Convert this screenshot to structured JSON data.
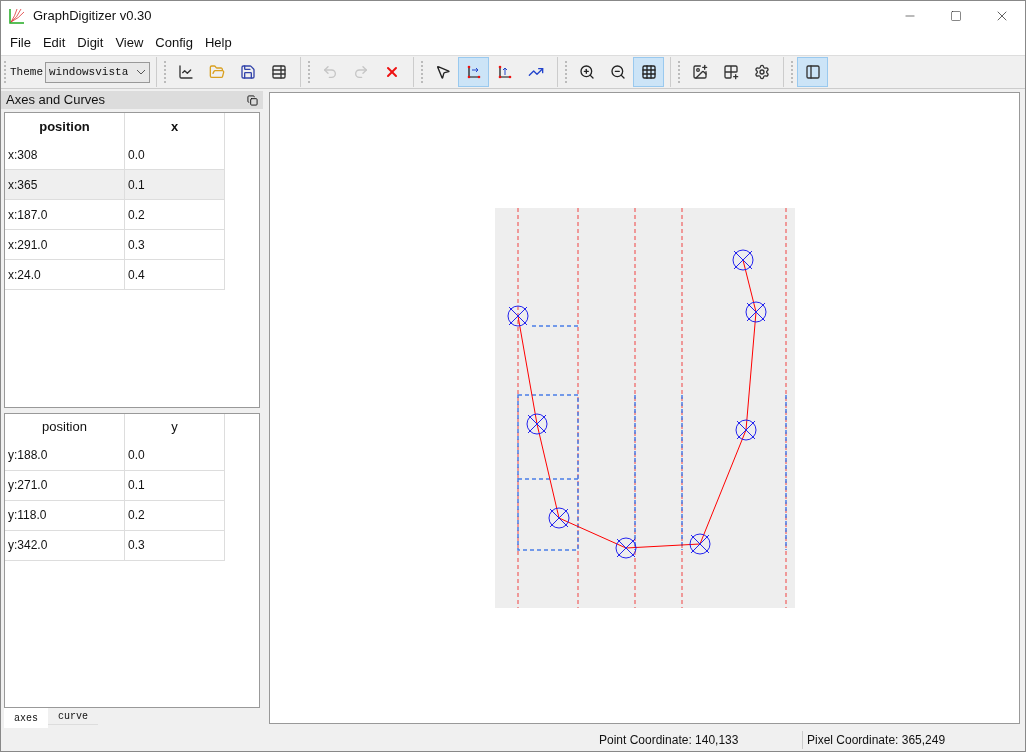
{
  "window": {
    "title": "GraphDigitizer v0.30"
  },
  "menu": [
    "File",
    "Edit",
    "Digit",
    "View",
    "Config",
    "Help"
  ],
  "toolbar": {
    "theme_label": "Theme",
    "theme_value": "windowsvista",
    "groups": [
      [
        {
          "kind": "chart",
          "selected": false
        },
        {
          "kind": "open",
          "selected": false
        },
        {
          "kind": "save",
          "selected": false
        },
        {
          "kind": "export",
          "selected": false
        }
      ],
      [
        {
          "kind": "undo",
          "selected": false,
          "disabled": true
        },
        {
          "kind": "redo",
          "selected": false,
          "disabled": true
        },
        {
          "kind": "delete",
          "selected": false,
          "disabled": false
        }
      ],
      [
        {
          "kind": "pointer",
          "selected": false
        },
        {
          "kind": "axis-x",
          "selected": true
        },
        {
          "kind": "axis-y",
          "selected": false
        },
        {
          "kind": "curve",
          "selected": false
        }
      ],
      [
        {
          "kind": "zoom-in",
          "selected": false
        },
        {
          "kind": "zoom-out",
          "selected": false
        },
        {
          "kind": "grid",
          "selected": true
        }
      ],
      [
        {
          "kind": "image",
          "selected": false
        },
        {
          "kind": "grid-settings",
          "selected": false
        },
        {
          "kind": "settings",
          "selected": false
        }
      ],
      [
        {
          "kind": "layout",
          "selected": true
        }
      ]
    ]
  },
  "panel": {
    "title": "Axes and Curves",
    "tables": [
      {
        "active": true,
        "columns": [
          "position",
          "x"
        ],
        "rows": [
          {
            "cells": [
              "x:308",
              "0.0"
            ],
            "selected": false
          },
          {
            "cells": [
              "x:365",
              "0.1"
            ],
            "selected": true
          },
          {
            "cells": [
              "x:187.0",
              "0.2"
            ],
            "selected": false
          },
          {
            "cells": [
              "x:291.0",
              "0.3"
            ],
            "selected": false
          },
          {
            "cells": [
              "x:24.0",
              "0.4"
            ],
            "selected": false
          }
        ]
      },
      {
        "active": false,
        "columns": [
          "position",
          "y"
        ],
        "rows": [
          {
            "cells": [
              "y:188.0",
              "0.0"
            ],
            "selected": false
          },
          {
            "cells": [
              "y:271.0",
              "0.1"
            ],
            "selected": false
          },
          {
            "cells": [
              "y:118.0",
              "0.2"
            ],
            "selected": false
          },
          {
            "cells": [
              "y:342.0",
              "0.3"
            ],
            "selected": false
          }
        ]
      }
    ],
    "tabs": [
      {
        "label": "axes",
        "selected": true
      },
      {
        "label": "curve",
        "selected": false
      }
    ]
  },
  "status_bar": [
    "Point Coordinate: 140,133",
    "Pixel Coordinate: 365,249"
  ]
}
